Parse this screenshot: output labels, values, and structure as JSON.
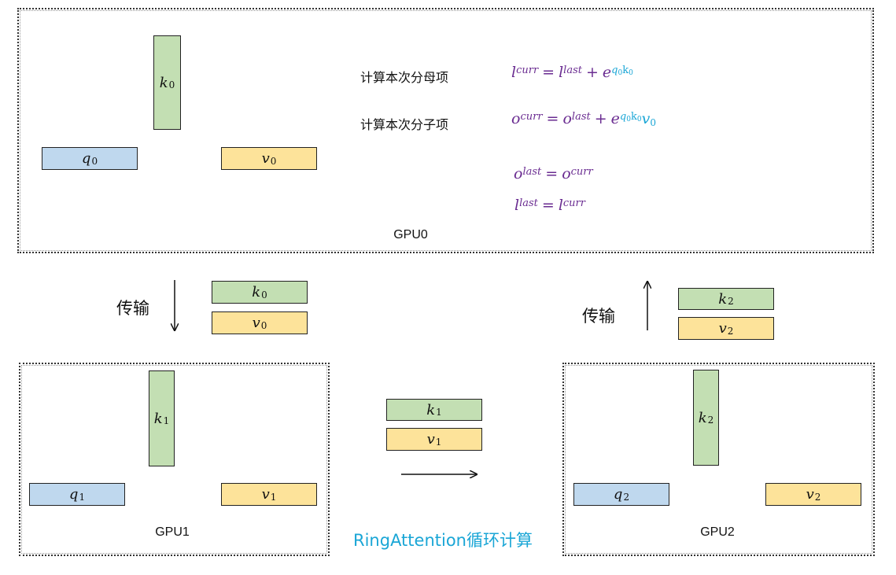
{
  "gpus": [
    {
      "label": "GPU0",
      "k": {
        "base": "k",
        "sub": "0"
      },
      "q": {
        "base": "q",
        "sub": "0"
      },
      "v": {
        "base": "v",
        "sub": "0"
      }
    },
    {
      "label": "GPU1",
      "k": {
        "base": "k",
        "sub": "1"
      },
      "q": {
        "base": "q",
        "sub": "1"
      },
      "v": {
        "base": "v",
        "sub": "1"
      }
    },
    {
      "label": "GPU2",
      "k": {
        "base": "k",
        "sub": "2"
      },
      "q": {
        "base": "q",
        "sub": "2"
      },
      "v": {
        "base": "v",
        "sub": "2"
      }
    }
  ],
  "annotations": {
    "denominator": "计算本次分母项",
    "numerator": "计算本次分子项"
  },
  "formulas": {
    "l_curr": {
      "base": "l",
      "sup": "curr"
    },
    "l_last": {
      "base": "l",
      "sup": "last"
    },
    "o_curr": {
      "base": "o",
      "sup": "curr"
    },
    "o_last": {
      "base": "o",
      "sup": "last"
    },
    "plus": "+",
    "equals": "=",
    "exp_base": "e",
    "q0": {
      "base": "q",
      "sub": "0"
    },
    "k0": {
      "base": "k",
      "sub": "0"
    },
    "v0": {
      "base": "v",
      "sub": "0"
    }
  },
  "transfers": [
    {
      "label": "传输",
      "k": {
        "base": "k",
        "sub": "0"
      },
      "v": {
        "base": "v",
        "sub": "0"
      }
    },
    {
      "label": "传输",
      "k": {
        "base": "k",
        "sub": "2"
      },
      "v": {
        "base": "v",
        "sub": "2"
      }
    },
    {
      "label": "",
      "k": {
        "base": "k",
        "sub": "1"
      },
      "v": {
        "base": "v",
        "sub": "1"
      }
    }
  ],
  "caption": "RingAttention循环计算",
  "colors": {
    "k_block": "#c3dfb3",
    "q_block": "#bfd8ee",
    "v_block": "#fde39a",
    "formula": "#6a2c91",
    "highlight": "#1aa6d6"
  }
}
